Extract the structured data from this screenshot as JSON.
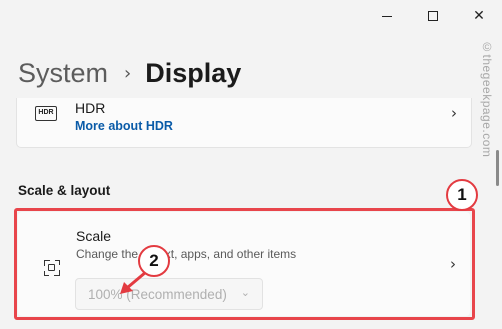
{
  "breadcrumb": {
    "parent": "System",
    "separator": "›",
    "current": "Display"
  },
  "window_controls": {
    "minimize_icon": "minimize-icon",
    "maximize_icon": "maximize-icon",
    "close_glyph": "✕"
  },
  "hdr": {
    "icon_text": "HDR",
    "title": "HDR",
    "link": "More about HDR",
    "chevron": "›"
  },
  "section_title": "Scale & layout",
  "scale": {
    "title": "Scale",
    "description": "Change the     of text, apps, and other items",
    "dropdown_value": "100% (Recommended)",
    "dropdown_arrow": "⌄",
    "chevron": "›"
  },
  "annotations": {
    "badge_1": "1",
    "badge_2": "2",
    "highlight_color": "#e8454b"
  },
  "watermark": "©thegeekpage.com",
  "colors": {
    "accent_link": "#0a5ba8",
    "background": "#f3f3f3",
    "card": "#fbfbfb"
  }
}
